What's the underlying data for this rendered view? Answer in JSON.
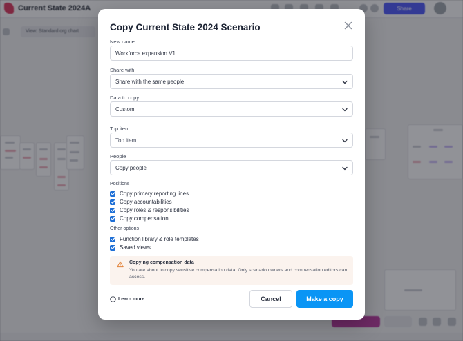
{
  "background": {
    "app_title": "Current State 2024A",
    "share_label": "Share",
    "view_label": "View: Standard org chart"
  },
  "modal": {
    "title": "Copy Current State 2024 Scenario",
    "new_name": {
      "label": "New name",
      "value": "Workforce expansion V1"
    },
    "share_with": {
      "label": "Share with",
      "value": "Share with the same people"
    },
    "data_to_copy": {
      "label": "Data to copy",
      "value": "Custom"
    },
    "top_item": {
      "label": "Top item",
      "placeholder": "Top item"
    },
    "people": {
      "label": "People",
      "value": "Copy people"
    },
    "positions": {
      "label": "Positions",
      "options": [
        {
          "label": "Copy primary reporting lines",
          "checked": true
        },
        {
          "label": "Copy accountabilities",
          "checked": true
        },
        {
          "label": "Copy roles & responsibilities",
          "checked": true
        },
        {
          "label": "Copy compensation",
          "checked": true
        }
      ]
    },
    "other_options": {
      "label": "Other options",
      "options": [
        {
          "label": "Function library & role templates",
          "checked": true
        },
        {
          "label": "Saved views",
          "checked": true
        }
      ]
    },
    "warning": {
      "title": "Copying compensation data",
      "body": "You are about to copy sensitive compensation data. Only scenario owners and compensation editors can access."
    },
    "learn_more": "Learn more",
    "cancel": "Cancel",
    "submit": "Make a copy"
  },
  "colors": {
    "primary": "#0a95f5",
    "checkbox": "#1e6fd6",
    "warning_bg": "#fbf3ee",
    "warning_icon": "#e2833a"
  },
  "icons": {
    "close": "close-icon",
    "chevron": "chevron-down-icon",
    "warning": "warning-triangle-icon",
    "info": "info-circle-icon",
    "check": "check-icon"
  }
}
